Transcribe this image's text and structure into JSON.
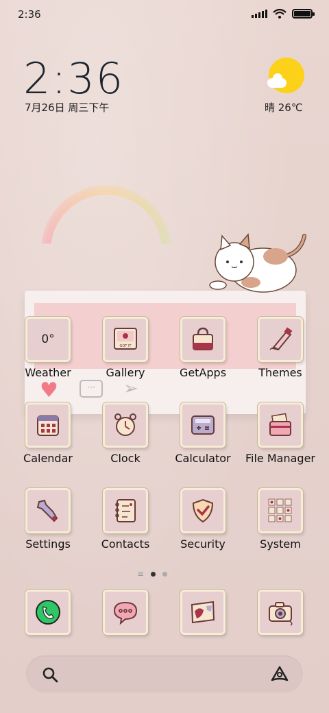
{
  "status_bar": {
    "time": "2:36",
    "icons": [
      "signal-icon",
      "wifi-icon",
      "battery-icon"
    ]
  },
  "clock_widget": {
    "time": "2:36",
    "date": "7月26日 周三下午"
  },
  "weather_widget": {
    "condition_temp": "晴 26℃",
    "icon": "sun-cloud-icon"
  },
  "apps_row1": [
    {
      "label": "Weather",
      "icon": "weather-app-icon",
      "tile_text": "0°"
    },
    {
      "label": "Gallery",
      "icon": "gallery-icon",
      "tile_text": "GOT IT"
    },
    {
      "label": "GetApps",
      "icon": "bag-icon"
    },
    {
      "label": "Themes",
      "icon": "paint-tube-icon"
    }
  ],
  "apps_row2": [
    {
      "label": "Calendar",
      "icon": "calendar-icon"
    },
    {
      "label": "Clock",
      "icon": "alarm-clock-icon"
    },
    {
      "label": "Calculator",
      "icon": "calculator-icon"
    },
    {
      "label": "File Manager",
      "icon": "folder-icon"
    }
  ],
  "apps_row3": [
    {
      "label": "Settings",
      "icon": "wrench-icon"
    },
    {
      "label": "Contacts",
      "icon": "notebook-icon"
    },
    {
      "label": "Security",
      "icon": "shield-icon"
    },
    {
      "label": "System",
      "icon": "system-folder-icon"
    }
  ],
  "dock": [
    {
      "icon": "phone-icon"
    },
    {
      "icon": "message-icon"
    },
    {
      "icon": "browser-map-icon"
    },
    {
      "icon": "camera-icon"
    }
  ],
  "page_indicator": {
    "pages": 2,
    "current": 1
  },
  "colors": {
    "wallpaper": "#e8d5d0",
    "tile": "#e7cfcf",
    "tile_border": "#f5ecd9",
    "accent_red": "#a8354a",
    "phone_green": "#2ec766",
    "sun": "#fcd11a"
  }
}
